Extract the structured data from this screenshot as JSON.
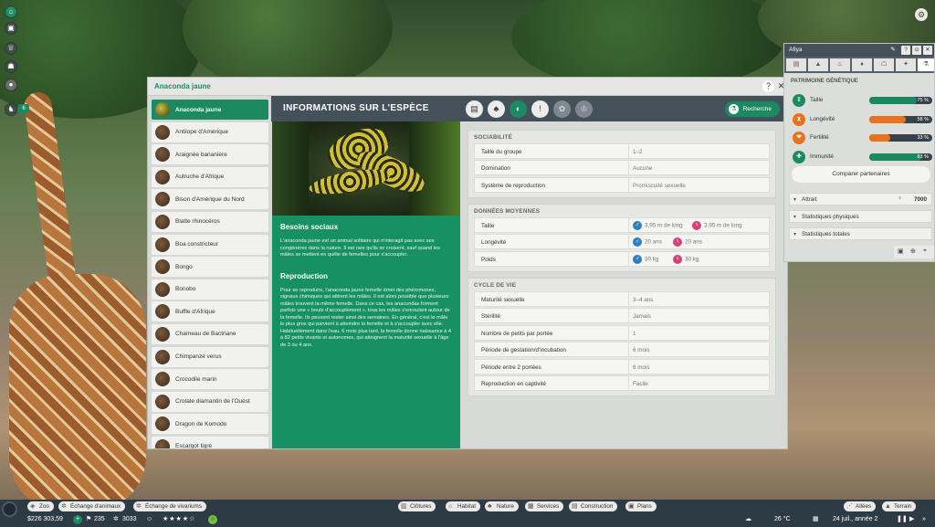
{
  "dialog": {
    "title": "Anaconda jaune"
  },
  "animals": [
    "Anaconda jaune",
    "Antilope d'Amérique",
    "Araignée bananière",
    "Autruche d'Afrique",
    "Bison d'Amérique du Nord",
    "Blatte rhinocéros",
    "Boa constricteur",
    "Bongo",
    "Bonobo",
    "Buffle d'Afrique",
    "Chameau de Bactriane",
    "Chimpanzé verus",
    "Crocodile marin",
    "Crotale diamantin de l'Ouest",
    "Dragon de Komodo",
    "Escargot tigre"
  ],
  "info": {
    "title": "INFORMATIONS SUR L'ESPÈCE",
    "research_label": "Recherche",
    "social_heading": "Besoins sociaux",
    "social_text": "L'anaconda jaune est un animal solitaire qui n'interagit pas avec ses congénères dans la nature. Il est rare qu'ils se croisent, sauf quand les mâles se mettent en quête de femelles pour s'accoupler.",
    "repro_heading": "Reproduction",
    "repro_text": "Pour se reproduire, l'anaconda jaune femelle émet des phéromones, signaux chimiques qui attirent les mâles. Il est alors possible que plusieurs mâles trouvent la même femelle. Dans ce cas, les anacondas forment parfois une « boule d'accouplement », tous les mâles s'enroulant autour de la femelle. Ils peuvent rester ainsi des semaines. En général, c'est le mâle le plus gros qui parvient à atteindre la femelle et à s'accoupler avec elle. Habituellement dans l'eau. 6 mois plus tard, la femelle donne naissance à 4 à 82 petits vivants et autonomes, qui atteignent la maturité sexuelle à l'âge de 3 ou 4 ans."
  },
  "sociability": {
    "heading": "SOCIABILITÉ",
    "rows": [
      {
        "k": "Taille du groupe",
        "v": "1–2"
      },
      {
        "k": "Domination",
        "v": "Aucune"
      },
      {
        "k": "Système de reproduction",
        "v": "Promiscuité sexuelle"
      }
    ]
  },
  "averages": {
    "heading": "DONNÉES MOYENNES",
    "rows": [
      {
        "k": "Taille",
        "m": "3,95 m de long",
        "f": "3,95 m de long"
      },
      {
        "k": "Longévité",
        "m": "20 ans",
        "f": "20 ans"
      },
      {
        "k": "Poids",
        "m": "30 kg",
        "f": "30 kg"
      }
    ]
  },
  "lifecycle": {
    "heading": "CYCLE DE VIE",
    "rows": [
      {
        "k": "Maturité sexuelle",
        "v": "3–4 ans"
      },
      {
        "k": "Stérilité",
        "v": "Jamais"
      },
      {
        "k": "Nombre de petits par portée",
        "v": "1"
      },
      {
        "k": "Période de gestation/d'incubation",
        "v": "6 mois"
      },
      {
        "k": "Période entre 2 portées",
        "v": "6 mois"
      },
      {
        "k": "Reproduction en captivité",
        "v": "Facile"
      }
    ]
  },
  "genetics": {
    "animal_name": "Afiya",
    "heading": "PATRIMOINE GÉNÉTIQUE",
    "stats": [
      {
        "name": "Taille",
        "pct": "75 %",
        "value": 0.75,
        "color": "#1b8a62"
      },
      {
        "name": "Longévité",
        "pct": "58 %",
        "value": 0.58,
        "color": "#e8731c"
      },
      {
        "name": "Fertilité",
        "pct": "33 %",
        "value": 0.33,
        "color": "#e8731c"
      },
      {
        "name": "Immunité",
        "pct": "83 %",
        "value": 0.83,
        "color": "#1b8a62"
      }
    ],
    "compare_label": "Comparer partenaires",
    "attrait_label": "Attrait",
    "attrait_value": "7000",
    "physical_label": "Statistiques physiques",
    "total_label": "Statistiques totales"
  },
  "toolbar": {
    "left": [
      "Zoo",
      "Échange d'animaux",
      "Échange de vivariums"
    ],
    "center": [
      "Clôtures",
      "Habitat",
      "Nature",
      "Services",
      "Construction",
      "Plans"
    ],
    "right": [
      "Allées",
      "Terrain"
    ]
  },
  "status": {
    "money": "$226 303,59",
    "guests": "235",
    "animals": "3033",
    "temperature": "26 °C",
    "date": "24 juil., année 2",
    "zoo_rating": 4
  },
  "sidebar": {
    "badge": "6"
  }
}
